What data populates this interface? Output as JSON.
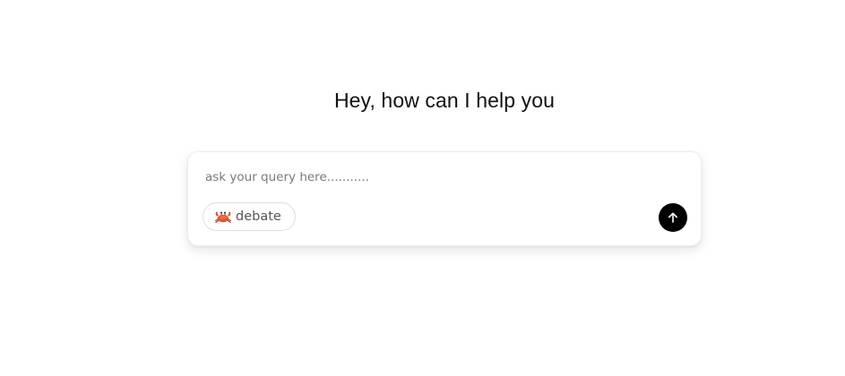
{
  "greeting": "Hey, how can I help you",
  "composer": {
    "placeholder": "ask your query here...........",
    "value": "",
    "mode_chip": {
      "icon": "crab-icon",
      "label": "debate"
    },
    "send_button": {
      "icon": "arrow-up-icon",
      "color": "#000000"
    }
  }
}
